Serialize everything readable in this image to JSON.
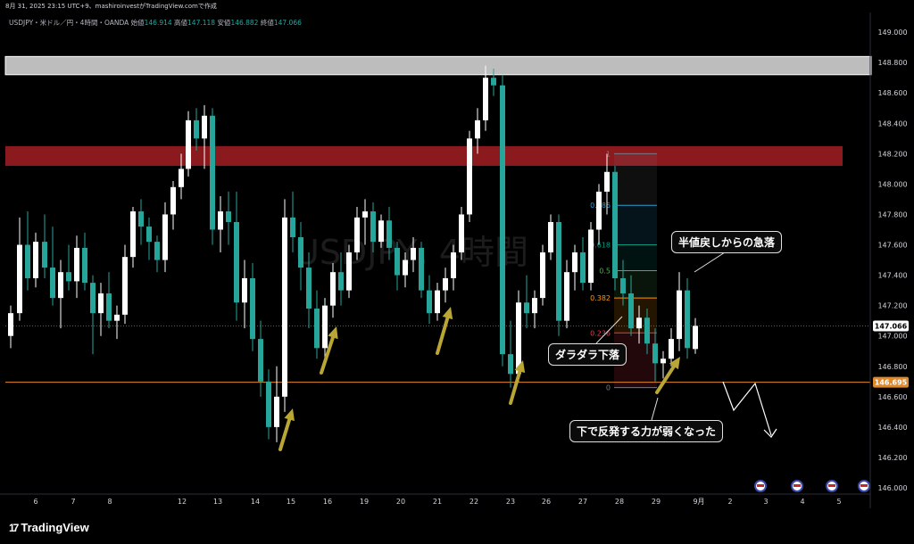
{
  "header": {
    "caption": "8月 31, 2025 23:15 UTC+9、mashiroinvestがTradingView.comで作成"
  },
  "legend": {
    "symbol": "USDJPY・米ドル／円・4時間・OANDA",
    "open_label": "始値",
    "open": "146.914",
    "high_label": "高値",
    "high": "147.118",
    "low_label": "安値",
    "low": "146.882",
    "close_label": "終値",
    "close": "147.066"
  },
  "watermark": "USDJPY, 4時間",
  "brand": {
    "name": "TradingView"
  },
  "annotations": {
    "quick_drop": "半値戻しからの急落",
    "sluggish_drop": "ダラダラ下落",
    "weak_rebound": "下で反発する力が弱くなった"
  },
  "colors": {
    "background": "#000000",
    "bull": "#ffffff",
    "bear": "#26a69a",
    "resistance_upper": "#bdbdbd",
    "resistance_lower": "#8b1a1f",
    "support_line": "#e0892a",
    "arrow": "#b9a635"
  },
  "chart_data": {
    "type": "candlestick",
    "symbol": "USDJPY",
    "timeframe": "4時間",
    "ylim": [
      146.0,
      149.1
    ],
    "y_ticks": [
      146.0,
      146.2,
      146.4,
      146.6,
      146.8,
      147.0,
      147.2,
      147.4,
      147.6,
      147.8,
      148.0,
      148.2,
      148.4,
      148.6,
      148.8,
      149.0
    ],
    "x_tick_labels": [
      "6",
      "7",
      "8",
      "12",
      "13",
      "14",
      "15",
      "16",
      "19",
      "20",
      "21",
      "22",
      "23",
      "26",
      "27",
      "28",
      "29",
      "9月",
      "2",
      "3",
      "4",
      "5"
    ],
    "price_labels": {
      "current": "147.066",
      "support": "146.695"
    },
    "zones": [
      {
        "name": "resistance-upper",
        "low": 148.72,
        "high": 148.84
      },
      {
        "name": "resistance-lower",
        "low": 148.12,
        "high": 148.25
      }
    ],
    "support_level": 146.695,
    "fibonacci": {
      "levels": [
        {
          "label": "1",
          "ratio": 1.0,
          "price": 148.2
        },
        {
          "label": "0.786",
          "ratio": 0.786,
          "price": 147.86
        },
        {
          "label": "0.618",
          "ratio": 0.618,
          "price": 147.6
        },
        {
          "label": "0.5",
          "ratio": 0.5,
          "price": 147.43
        },
        {
          "label": "0.382",
          "ratio": 0.382,
          "price": 147.25
        },
        {
          "label": "0.236",
          "ratio": 0.236,
          "price": 147.02
        },
        {
          "label": "0",
          "ratio": 0.0,
          "price": 146.66
        }
      ]
    },
    "candles": [
      {
        "x": 12,
        "o": 147.0,
        "h": 147.2,
        "l": 146.92,
        "c": 147.15
      },
      {
        "x": 22,
        "o": 147.15,
        "h": 147.78,
        "l": 147.1,
        "c": 147.6
      },
      {
        "x": 31,
        "o": 147.6,
        "h": 147.82,
        "l": 147.3,
        "c": 147.38
      },
      {
        "x": 40,
        "o": 147.38,
        "h": 147.68,
        "l": 147.32,
        "c": 147.62
      },
      {
        "x": 50,
        "o": 147.62,
        "h": 147.8,
        "l": 147.38,
        "c": 147.45
      },
      {
        "x": 59,
        "o": 147.45,
        "h": 147.72,
        "l": 147.2,
        "c": 147.25
      },
      {
        "x": 68,
        "o": 147.25,
        "h": 147.5,
        "l": 147.05,
        "c": 147.42
      },
      {
        "x": 77,
        "o": 147.42,
        "h": 147.6,
        "l": 147.3,
        "c": 147.36
      },
      {
        "x": 86,
        "o": 147.36,
        "h": 147.66,
        "l": 147.25,
        "c": 147.58
      },
      {
        "x": 95,
        "o": 147.58,
        "h": 147.68,
        "l": 147.3,
        "c": 147.35
      },
      {
        "x": 104,
        "o": 147.35,
        "h": 147.4,
        "l": 146.88,
        "c": 147.15
      },
      {
        "x": 113,
        "o": 147.15,
        "h": 147.35,
        "l": 147.0,
        "c": 147.28
      },
      {
        "x": 122,
        "o": 147.28,
        "h": 147.42,
        "l": 147.05,
        "c": 147.1
      },
      {
        "x": 131,
        "o": 147.1,
        "h": 147.2,
        "l": 146.98,
        "c": 147.14
      },
      {
        "x": 140,
        "o": 147.14,
        "h": 147.6,
        "l": 147.08,
        "c": 147.52
      },
      {
        "x": 149,
        "o": 147.52,
        "h": 147.85,
        "l": 147.45,
        "c": 147.82
      },
      {
        "x": 158,
        "o": 147.82,
        "h": 147.9,
        "l": 147.6,
        "c": 147.72
      },
      {
        "x": 167,
        "o": 147.72,
        "h": 147.78,
        "l": 147.5,
        "c": 147.62
      },
      {
        "x": 176,
        "o": 147.62,
        "h": 147.66,
        "l": 147.42,
        "c": 147.5
      },
      {
        "x": 185,
        "o": 147.5,
        "h": 147.88,
        "l": 147.42,
        "c": 147.8
      },
      {
        "x": 194,
        "o": 147.8,
        "h": 148.02,
        "l": 147.7,
        "c": 147.98
      },
      {
        "x": 203,
        "o": 147.98,
        "h": 148.2,
        "l": 147.9,
        "c": 148.1
      },
      {
        "x": 211,
        "o": 148.1,
        "h": 148.48,
        "l": 148.05,
        "c": 148.42
      },
      {
        "x": 220,
        "o": 148.42,
        "h": 148.5,
        "l": 148.22,
        "c": 148.3
      },
      {
        "x": 229,
        "o": 148.3,
        "h": 148.52,
        "l": 148.1,
        "c": 148.45
      },
      {
        "x": 238,
        "o": 148.45,
        "h": 148.5,
        "l": 147.6,
        "c": 147.7
      },
      {
        "x": 247,
        "o": 147.7,
        "h": 147.92,
        "l": 147.55,
        "c": 147.82
      },
      {
        "x": 256,
        "o": 147.82,
        "h": 147.95,
        "l": 147.6,
        "c": 147.75
      },
      {
        "x": 265,
        "o": 147.75,
        "h": 147.95,
        "l": 147.1,
        "c": 147.22
      },
      {
        "x": 274,
        "o": 147.22,
        "h": 147.5,
        "l": 147.05,
        "c": 147.38
      },
      {
        "x": 283,
        "o": 147.38,
        "h": 147.48,
        "l": 146.9,
        "c": 146.98
      },
      {
        "x": 292,
        "o": 146.98,
        "h": 147.1,
        "l": 146.6,
        "c": 146.7
      },
      {
        "x": 301,
        "o": 146.7,
        "h": 146.78,
        "l": 146.32,
        "c": 146.4
      },
      {
        "x": 310,
        "o": 146.4,
        "h": 146.8,
        "l": 146.3,
        "c": 146.6
      },
      {
        "x": 319,
        "o": 146.6,
        "h": 147.9,
        "l": 146.5,
        "c": 147.78
      },
      {
        "x": 328,
        "o": 147.78,
        "h": 147.95,
        "l": 147.55,
        "c": 147.65
      },
      {
        "x": 337,
        "o": 147.65,
        "h": 147.75,
        "l": 147.3,
        "c": 147.45
      },
      {
        "x": 346,
        "o": 147.45,
        "h": 147.55,
        "l": 147.05,
        "c": 147.18
      },
      {
        "x": 355,
        "o": 147.18,
        "h": 147.3,
        "l": 146.85,
        "c": 146.92
      },
      {
        "x": 364,
        "o": 146.92,
        "h": 147.25,
        "l": 146.85,
        "c": 147.2
      },
      {
        "x": 373,
        "o": 147.2,
        "h": 147.48,
        "l": 147.12,
        "c": 147.42
      },
      {
        "x": 382,
        "o": 147.42,
        "h": 147.55,
        "l": 147.2,
        "c": 147.3
      },
      {
        "x": 391,
        "o": 147.3,
        "h": 147.6,
        "l": 147.25,
        "c": 147.55
      },
      {
        "x": 400,
        "o": 147.55,
        "h": 147.85,
        "l": 147.5,
        "c": 147.78
      },
      {
        "x": 409,
        "o": 147.78,
        "h": 147.9,
        "l": 147.6,
        "c": 147.82
      },
      {
        "x": 418,
        "o": 147.82,
        "h": 147.88,
        "l": 147.55,
        "c": 147.62
      },
      {
        "x": 427,
        "o": 147.62,
        "h": 147.8,
        "l": 147.58,
        "c": 147.76
      },
      {
        "x": 436,
        "o": 147.76,
        "h": 147.85,
        "l": 147.5,
        "c": 147.58
      },
      {
        "x": 445,
        "o": 147.58,
        "h": 147.62,
        "l": 147.3,
        "c": 147.4
      },
      {
        "x": 454,
        "o": 147.4,
        "h": 147.55,
        "l": 147.32,
        "c": 147.5
      },
      {
        "x": 463,
        "o": 147.5,
        "h": 147.65,
        "l": 147.42,
        "c": 147.58
      },
      {
        "x": 472,
        "o": 147.58,
        "h": 147.62,
        "l": 147.25,
        "c": 147.3
      },
      {
        "x": 481,
        "o": 147.3,
        "h": 147.4,
        "l": 147.08,
        "c": 147.15
      },
      {
        "x": 490,
        "o": 147.15,
        "h": 147.35,
        "l": 147.1,
        "c": 147.3
      },
      {
        "x": 499,
        "o": 147.3,
        "h": 147.45,
        "l": 147.22,
        "c": 147.38
      },
      {
        "x": 508,
        "o": 147.38,
        "h": 147.6,
        "l": 147.3,
        "c": 147.55
      },
      {
        "x": 517,
        "o": 147.55,
        "h": 147.85,
        "l": 147.5,
        "c": 147.8
      },
      {
        "x": 526,
        "o": 147.8,
        "h": 148.35,
        "l": 147.75,
        "c": 148.3
      },
      {
        "x": 535,
        "o": 148.3,
        "h": 148.5,
        "l": 148.2,
        "c": 148.42
      },
      {
        "x": 544,
        "o": 148.42,
        "h": 148.78,
        "l": 148.35,
        "c": 148.7
      },
      {
        "x": 553,
        "o": 148.7,
        "h": 148.76,
        "l": 148.58,
        "c": 148.65
      },
      {
        "x": 563,
        "o": 148.65,
        "h": 148.72,
        "l": 146.8,
        "c": 146.88
      },
      {
        "x": 572,
        "o": 146.88,
        "h": 147.1,
        "l": 146.66,
        "c": 146.75
      },
      {
        "x": 581,
        "o": 146.75,
        "h": 147.3,
        "l": 146.7,
        "c": 147.22
      },
      {
        "x": 590,
        "o": 147.22,
        "h": 147.4,
        "l": 147.05,
        "c": 147.15
      },
      {
        "x": 599,
        "o": 147.15,
        "h": 147.3,
        "l": 147.05,
        "c": 147.25
      },
      {
        "x": 608,
        "o": 147.25,
        "h": 147.6,
        "l": 147.2,
        "c": 147.55
      },
      {
        "x": 617,
        "o": 147.55,
        "h": 147.8,
        "l": 147.5,
        "c": 147.75
      },
      {
        "x": 626,
        "o": 147.75,
        "h": 147.8,
        "l": 147.0,
        "c": 147.1
      },
      {
        "x": 635,
        "o": 147.1,
        "h": 147.5,
        "l": 147.05,
        "c": 147.42
      },
      {
        "x": 644,
        "o": 147.42,
        "h": 147.6,
        "l": 147.3,
        "c": 147.55
      },
      {
        "x": 653,
        "o": 147.55,
        "h": 147.65,
        "l": 147.3,
        "c": 147.35
      },
      {
        "x": 662,
        "o": 147.35,
        "h": 147.75,
        "l": 147.3,
        "c": 147.7
      },
      {
        "x": 671,
        "o": 147.7,
        "h": 148.0,
        "l": 147.6,
        "c": 147.95
      },
      {
        "x": 680,
        "o": 147.95,
        "h": 148.2,
        "l": 147.8,
        "c": 148.08
      },
      {
        "x": 689,
        "o": 148.08,
        "h": 148.12,
        "l": 147.3,
        "c": 147.38
      },
      {
        "x": 698,
        "o": 147.38,
        "h": 147.5,
        "l": 147.2,
        "c": 147.28
      },
      {
        "x": 707,
        "o": 147.28,
        "h": 147.4,
        "l": 147.0,
        "c": 147.05
      },
      {
        "x": 716,
        "o": 147.05,
        "h": 147.2,
        "l": 146.95,
        "c": 147.12
      },
      {
        "x": 725,
        "o": 147.12,
        "h": 147.18,
        "l": 146.88,
        "c": 146.95
      },
      {
        "x": 734,
        "o": 146.95,
        "h": 147.05,
        "l": 146.7,
        "c": 146.82
      },
      {
        "x": 743,
        "o": 146.82,
        "h": 146.9,
        "l": 146.72,
        "c": 146.85
      },
      {
        "x": 752,
        "o": 146.85,
        "h": 147.05,
        "l": 146.8,
        "c": 146.98
      },
      {
        "x": 761,
        "o": 146.98,
        "h": 147.42,
        "l": 146.9,
        "c": 147.3
      },
      {
        "x": 770,
        "o": 147.3,
        "h": 147.38,
        "l": 146.85,
        "c": 146.92
      },
      {
        "x": 779,
        "o": 146.914,
        "h": 147.118,
        "l": 146.882,
        "c": 147.066
      }
    ]
  }
}
